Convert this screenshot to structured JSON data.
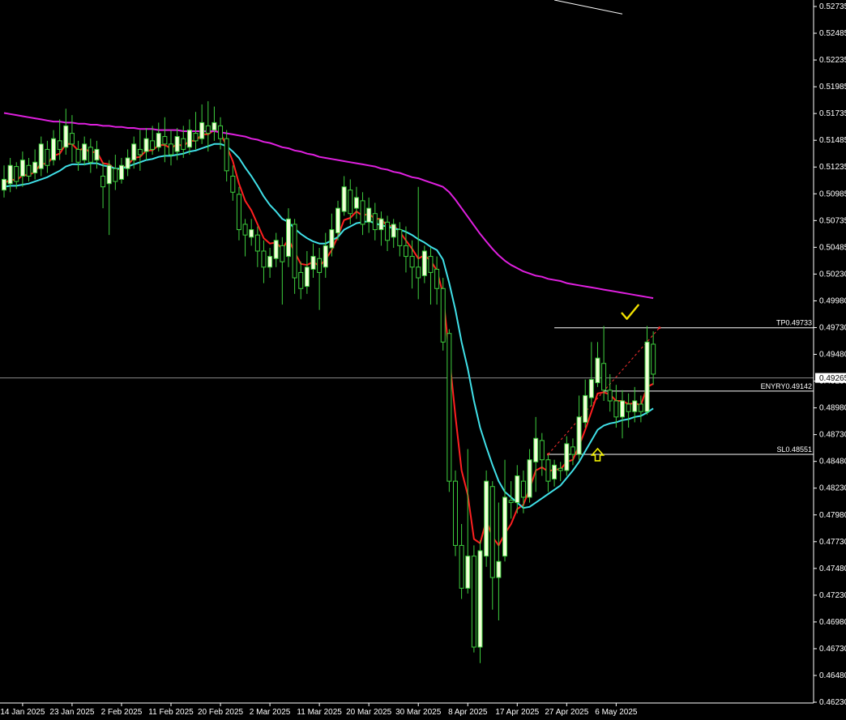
{
  "chart_data": {
    "type": "candlestick",
    "y_axis": {
      "range": [
        0.46195,
        0.52808
      ],
      "ticks": [
        "0.52735",
        "0.52485",
        "0.52235",
        "0.51985",
        "0.51735",
        "0.51485",
        "0.51235",
        "0.50985",
        "0.50735",
        "0.50485",
        "0.50230",
        "0.49980",
        "0.49730",
        "0.49480",
        "0.49230",
        "0.48980",
        "0.48730",
        "0.48480",
        "0.48230",
        "0.47980",
        "0.47730",
        "0.47480",
        "0.47230",
        "0.46980",
        "0.46730",
        "0.46480",
        "0.46230"
      ]
    },
    "x_axis": {
      "labels": [
        {
          "text": "14 Jan 2025",
          "bar": 3
        },
        {
          "text": "23 Jan 2025",
          "bar": 11
        },
        {
          "text": "2 Feb 2025",
          "bar": 19
        },
        {
          "text": "11 Feb 2025",
          "bar": 27
        },
        {
          "text": "20 Feb 2025",
          "bar": 35
        },
        {
          "text": "2 Mar 2025",
          "bar": 43
        },
        {
          "text": "11 Mar 2025",
          "bar": 51
        },
        {
          "text": "20 Mar 2025",
          "bar": 59
        },
        {
          "text": "30 Mar 2025",
          "bar": 67
        },
        {
          "text": "8 Apr 2025",
          "bar": 75
        },
        {
          "text": "17 Apr 2025",
          "bar": 83
        },
        {
          "text": "27 Apr 2025",
          "bar": 91
        },
        {
          "text": "6 May 2025",
          "bar": 99
        }
      ]
    },
    "bar_spacing_note": "fixed bar slots, earliest at left",
    "current_price": "0.49265",
    "levels": [
      {
        "label": "TP0.49733",
        "price": 0.49733,
        "from_bar": 89
      },
      {
        "label": "ENYRY0.49142",
        "price": 0.49142,
        "from_bar": 97
      },
      {
        "label": "SL0.48551",
        "price": 0.48551,
        "from_bar": 88
      }
    ],
    "trade_line": {
      "from": {
        "bar": 88,
        "price": 0.48551
      },
      "to": {
        "bar": 106,
        "price": 0.49733
      }
    },
    "top_line": {
      "from": {
        "bar": 89,
        "price": 0.52808
      },
      "to": {
        "bar": 100,
        "price": 0.52665
      }
    },
    "candles": [
      [
        0.5102,
        0.5112,
        0.5095,
        0.5125
      ],
      [
        0.5108,
        0.5125,
        0.51,
        0.5132
      ],
      [
        0.5124,
        0.511,
        0.5103,
        0.5128
      ],
      [
        0.5115,
        0.513,
        0.5105,
        0.5138
      ],
      [
        0.5125,
        0.5115,
        0.511,
        0.5132
      ],
      [
        0.5118,
        0.5128,
        0.5112,
        0.514
      ],
      [
        0.5122,
        0.5145,
        0.5115,
        0.5152
      ],
      [
        0.514,
        0.5125,
        0.5118,
        0.5148
      ],
      [
        0.513,
        0.515,
        0.5125,
        0.5158
      ],
      [
        0.5148,
        0.514,
        0.513,
        0.5168
      ],
      [
        0.5142,
        0.5162,
        0.5135,
        0.5178
      ],
      [
        0.5155,
        0.5145,
        0.5128,
        0.5172
      ],
      [
        0.514,
        0.5128,
        0.512,
        0.5148
      ],
      [
        0.513,
        0.5145,
        0.5125,
        0.5152
      ],
      [
        0.5142,
        0.5128,
        0.5118,
        0.515
      ],
      [
        0.513,
        0.514,
        0.5122,
        0.5148
      ],
      [
        0.5115,
        0.5105,
        0.5085,
        0.5128
      ],
      [
        0.5108,
        0.5125,
        0.506,
        0.513
      ],
      [
        0.5122,
        0.511,
        0.5102,
        0.5135
      ],
      [
        0.5112,
        0.5125,
        0.5108,
        0.5132
      ],
      [
        0.5122,
        0.5132,
        0.5115,
        0.514
      ],
      [
        0.513,
        0.5145,
        0.5122,
        0.5152
      ],
      [
        0.514,
        0.5135,
        0.512,
        0.5158
      ],
      [
        0.5138,
        0.515,
        0.513,
        0.516
      ],
      [
        0.5148,
        0.514,
        0.5135,
        0.5162
      ],
      [
        0.5142,
        0.5155,
        0.5138,
        0.5165
      ],
      [
        0.5152,
        0.5145,
        0.5128,
        0.517
      ],
      [
        0.5145,
        0.5135,
        0.5125,
        0.5158
      ],
      [
        0.5138,
        0.5152,
        0.513,
        0.516
      ],
      [
        0.515,
        0.514,
        0.5132,
        0.5162
      ],
      [
        0.5142,
        0.5158,
        0.5135,
        0.5168
      ],
      [
        0.5155,
        0.5148,
        0.514,
        0.5175
      ],
      [
        0.515,
        0.5165,
        0.5145,
        0.5182
      ],
      [
        0.5162,
        0.5155,
        0.5138,
        0.5185
      ],
      [
        0.5158,
        0.5165,
        0.5148,
        0.518
      ],
      [
        0.5162,
        0.515,
        0.514,
        0.517
      ],
      [
        0.515,
        0.512,
        0.511,
        0.5158
      ],
      [
        0.5115,
        0.51,
        0.5092,
        0.5125
      ],
      [
        0.5098,
        0.5065,
        0.5055,
        0.5105
      ],
      [
        0.507,
        0.506,
        0.504,
        0.5075
      ],
      [
        0.5058,
        0.5065,
        0.505,
        0.5075
      ],
      [
        0.506,
        0.5045,
        0.503,
        0.5068
      ],
      [
        0.5045,
        0.503,
        0.5015,
        0.5055
      ],
      [
        0.503,
        0.504,
        0.502,
        0.5048
      ],
      [
        0.5038,
        0.5055,
        0.503,
        0.5062
      ],
      [
        0.505,
        0.5035,
        0.4995,
        0.5058
      ],
      [
        0.504,
        0.5075,
        0.503,
        0.5085
      ],
      [
        0.507,
        0.502,
        0.5005,
        0.5075
      ],
      [
        0.5025,
        0.501,
        0.5,
        0.5035
      ],
      [
        0.5012,
        0.503,
        0.5005,
        0.5045
      ],
      [
        0.5028,
        0.504,
        0.502,
        0.5052
      ],
      [
        0.5038,
        0.5025,
        0.499,
        0.5048
      ],
      [
        0.503,
        0.505,
        0.502,
        0.5062
      ],
      [
        0.5048,
        0.5065,
        0.504,
        0.508
      ],
      [
        0.5062,
        0.5085,
        0.5055,
        0.5092
      ],
      [
        0.5082,
        0.5105,
        0.5078,
        0.5115
      ],
      [
        0.5102,
        0.508,
        0.507,
        0.5112
      ],
      [
        0.5085,
        0.5095,
        0.5075,
        0.5105
      ],
      [
        0.5092,
        0.507,
        0.506,
        0.51
      ],
      [
        0.5072,
        0.5085,
        0.5062,
        0.5095
      ],
      [
        0.508,
        0.5065,
        0.5055,
        0.509
      ],
      [
        0.5065,
        0.5075,
        0.505,
        0.5082
      ],
      [
        0.5072,
        0.5055,
        0.5045,
        0.5078
      ],
      [
        0.5058,
        0.507,
        0.5048,
        0.5075
      ],
      [
        0.5065,
        0.505,
        0.504,
        0.5072
      ],
      [
        0.505,
        0.504,
        0.5025,
        0.5068
      ],
      [
        0.504,
        0.503,
        0.501,
        0.5055
      ],
      [
        0.503,
        0.502,
        0.5,
        0.5105
      ],
      [
        0.5022,
        0.5045,
        0.5015,
        0.505
      ],
      [
        0.504,
        0.5025,
        0.4995,
        0.5048
      ],
      [
        0.5028,
        0.501,
        0.4995,
        0.504
      ],
      [
        0.501,
        0.496,
        0.4952,
        0.502
      ],
      [
        0.4968,
        0.483,
        0.482,
        0.4972
      ],
      [
        0.483,
        0.477,
        0.476,
        0.484
      ],
      [
        0.477,
        0.473,
        0.472,
        0.479
      ],
      [
        0.473,
        0.476,
        0.4725,
        0.486
      ],
      [
        0.476,
        0.4675,
        0.467,
        0.477
      ],
      [
        0.4675,
        0.4765,
        0.466,
        0.4775
      ],
      [
        0.476,
        0.483,
        0.475,
        0.484
      ],
      [
        0.4825,
        0.474,
        0.471,
        0.483
      ],
      [
        0.474,
        0.4755,
        0.47,
        0.481
      ],
      [
        0.476,
        0.4815,
        0.4755,
        0.485
      ],
      [
        0.4812,
        0.481,
        0.4795,
        0.483
      ],
      [
        0.481,
        0.4835,
        0.48,
        0.4845
      ],
      [
        0.483,
        0.4815,
        0.48,
        0.484
      ],
      [
        0.4815,
        0.485,
        0.481,
        0.486
      ],
      [
        0.4848,
        0.487,
        0.482,
        0.489
      ],
      [
        0.4868,
        0.485,
        0.4835,
        0.4875
      ],
      [
        0.485,
        0.483,
        0.482,
        0.4855
      ],
      [
        0.4832,
        0.4845,
        0.4825,
        0.485
      ],
      [
        0.4842,
        0.484,
        0.483,
        0.4848
      ],
      [
        0.484,
        0.4865,
        0.4835,
        0.4872
      ],
      [
        0.4862,
        0.4855,
        0.4845,
        0.487
      ],
      [
        0.4855,
        0.489,
        0.485,
        0.491
      ],
      [
        0.4885,
        0.491,
        0.488,
        0.4925
      ],
      [
        0.4908,
        0.4925,
        0.49,
        0.496
      ],
      [
        0.4922,
        0.4945,
        0.4918,
        0.496
      ],
      [
        0.494,
        0.4915,
        0.4905,
        0.4975
      ],
      [
        0.4915,
        0.4905,
        0.4895,
        0.493
      ],
      [
        0.4905,
        0.489,
        0.488,
        0.492
      ],
      [
        0.489,
        0.4905,
        0.487,
        0.4915
      ],
      [
        0.4902,
        0.4895,
        0.488,
        0.4912
      ],
      [
        0.4895,
        0.4905,
        0.4885,
        0.4918
      ],
      [
        0.4902,
        0.4895,
        0.4885,
        0.491
      ],
      [
        0.4895,
        0.496,
        0.4892,
        0.4975
      ],
      [
        0.4958,
        0.493,
        0.492,
        0.497
      ]
    ],
    "series": [
      {
        "color": "#ff2020",
        "values": [
          0.5108,
          0.5112,
          0.5111,
          0.5116,
          0.5116,
          0.5119,
          0.5127,
          0.5126,
          0.5134,
          0.5136,
          0.5145,
          0.5145,
          0.5139,
          0.5141,
          0.5137,
          0.5138,
          0.5127,
          0.5126,
          0.5121,
          0.5122,
          0.5125,
          0.5132,
          0.5133,
          0.5139,
          0.5139,
          0.5144,
          0.5144,
          0.5141,
          0.5145,
          0.5143,
          0.5148,
          0.5148,
          0.5154,
          0.5154,
          0.5158,
          0.5155,
          0.5143,
          0.5129,
          0.5108,
          0.5092,
          0.5083,
          0.507,
          0.5057,
          0.5052,
          0.5053,
          0.5047,
          0.5056,
          0.5044,
          0.5033,
          0.5032,
          0.5035,
          0.5031,
          0.5037,
          0.5046,
          0.5059,
          0.5074,
          0.5076,
          0.5082,
          0.5078,
          0.508,
          0.5075,
          0.5075,
          0.5068,
          0.5069,
          0.5063,
          0.5055,
          0.5047,
          0.5038,
          0.5041,
          0.5036,
          0.5027,
          0.5005,
          0.4947,
          0.4891,
          0.484,
          0.4817,
          0.4776,
          0.4772,
          0.4793,
          0.4778,
          0.477,
          0.4781,
          0.479,
          0.4804,
          0.4808,
          0.4823,
          0.484,
          0.4843,
          0.4839,
          0.4841,
          0.4841,
          0.4848,
          0.485,
          0.4863,
          0.4878,
          0.4895,
          0.4912,
          0.4913,
          0.4911,
          0.4905,
          0.4905,
          0.4902,
          0.4903,
          0.4901,
          0.4918,
          0.4921
        ]
      },
      {
        "color": "#40e0e8",
        "values": [
          0.5105,
          0.5106,
          0.5106,
          0.5107,
          0.5108,
          0.511,
          0.5112,
          0.5114,
          0.5117,
          0.512,
          0.5124,
          0.5126,
          0.5126,
          0.5126,
          0.5127,
          0.5127,
          0.5125,
          0.5124,
          0.5122,
          0.5122,
          0.5124,
          0.5126,
          0.5128,
          0.513,
          0.5131,
          0.5133,
          0.5134,
          0.5134,
          0.5135,
          0.5136,
          0.5138,
          0.5139,
          0.5141,
          0.5143,
          0.5145,
          0.5145,
          0.5143,
          0.5138,
          0.5132,
          0.5123,
          0.5115,
          0.5106,
          0.5096,
          0.5088,
          0.5082,
          0.5075,
          0.5072,
          0.5066,
          0.5061,
          0.5057,
          0.5054,
          0.5052,
          0.5052,
          0.5055,
          0.5058,
          0.5065,
          0.5068,
          0.5071,
          0.5072,
          0.5073,
          0.5071,
          0.5069,
          0.5068,
          0.5066,
          0.5065,
          0.5063,
          0.506,
          0.5056,
          0.5053,
          0.5049,
          0.5046,
          0.5037,
          0.5015,
          0.499,
          0.496,
          0.4935,
          0.4905,
          0.488,
          0.4862,
          0.4845,
          0.483,
          0.482,
          0.4815,
          0.481,
          0.4805,
          0.4806,
          0.481,
          0.4814,
          0.4818,
          0.4822,
          0.4826,
          0.4833,
          0.484,
          0.4848,
          0.4858,
          0.4868,
          0.4878,
          0.4882,
          0.4884,
          0.4885,
          0.4887,
          0.4888,
          0.489,
          0.4891,
          0.4894,
          0.4898
        ]
      },
      {
        "color": "#e020e0",
        "values": [
          0.5174,
          0.5173,
          0.5172,
          0.5171,
          0.517,
          0.5169,
          0.5168,
          0.5167,
          0.5166,
          0.5166,
          0.5165,
          0.5165,
          0.5164,
          0.5164,
          0.5163,
          0.5163,
          0.5162,
          0.5162,
          0.5161,
          0.5161,
          0.516,
          0.516,
          0.5159,
          0.5159,
          0.5159,
          0.5158,
          0.5158,
          0.5158,
          0.5158,
          0.5157,
          0.5157,
          0.5157,
          0.5157,
          0.5157,
          0.5157,
          0.5156,
          0.5155,
          0.5154,
          0.5153,
          0.5152,
          0.515,
          0.5149,
          0.5147,
          0.5146,
          0.5144,
          0.5142,
          0.5141,
          0.5139,
          0.5138,
          0.5136,
          0.5135,
          0.5133,
          0.5132,
          0.5131,
          0.513,
          0.5129,
          0.5128,
          0.5127,
          0.5126,
          0.5125,
          0.5124,
          0.5122,
          0.5121,
          0.5119,
          0.5118,
          0.5116,
          0.5114,
          0.5113,
          0.5111,
          0.5109,
          0.5107,
          0.5105,
          0.51,
          0.5093,
          0.5085,
          0.5077,
          0.5069,
          0.5061,
          0.5054,
          0.5047,
          0.5041,
          0.5036,
          0.5032,
          0.5029,
          0.5026,
          0.5024,
          0.5022,
          0.5021,
          0.5019,
          0.5018,
          0.5017,
          0.5015,
          0.5014,
          0.5013,
          0.5012,
          0.5011,
          0.501,
          0.5009,
          0.5008,
          0.5007,
          0.5006,
          0.5005,
          0.5004,
          0.5003,
          0.5002,
          0.5001
        ]
      }
    ]
  },
  "colors": {
    "background": "#000000",
    "bull_body": "#f2ffd8",
    "bear_body": "#000000",
    "wick": "#3ecf3e",
    "axis": "#ffffff",
    "level_line": "#ffffff",
    "trade_line": "#ff3030",
    "arrow": "#f0f000",
    "checkmark": "#f0e000",
    "current_price_bg": "#ffffff",
    "current_price_text": "#000000"
  },
  "markers": {
    "arrow_icon": "up-arrow-outline-icon",
    "check_icon": "checkmark-icon"
  }
}
